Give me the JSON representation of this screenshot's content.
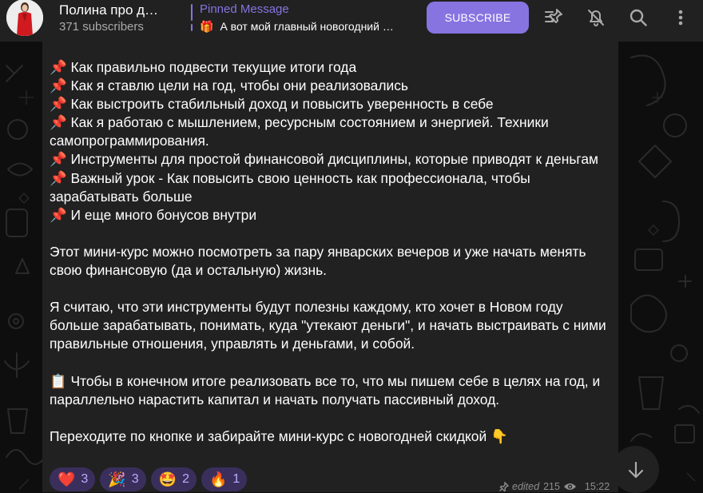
{
  "header": {
    "channel_title": "Полина про д…",
    "subscribers": "371 subscribers",
    "pinned_label": "Pinned Message",
    "pinned_emoji": "🎁",
    "pinned_text": "А вот мой главный новогодний …",
    "subscribe_label": "SUBSCRIBE",
    "icons": [
      "pinned-list-icon",
      "mute-bell-icon",
      "search-icon",
      "more-vertical-icon"
    ]
  },
  "message": {
    "lines": [
      "📌  Как правильно подвести текущие итоги года",
      "📌  Как я ставлю цели на год, чтобы они реализовались",
      "📌  Как выстроить стабильный доход и повысить уверенность в себе",
      "📌  Как я работаю с мышлением, ресурсным состоянием и энергией. Техники самопрограммирования.",
      "📌  Инструменты для простой финансовой дисциплины, которые приводят к деньгам",
      "📌  Важный урок - Как повысить свою ценность как профессионала, чтобы зарабатывать больше",
      "📌  И еще много бонусов внутри"
    ],
    "paragraph_1": "Этот мини-курс можно посмотреть за пару январских вечеров и уже начать менять свою финансовую (да и остальную) жизнь.",
    "paragraph_2": "Я считаю, что эти инструменты будут полезны каждому, кто хочет в Новом году больше зарабатывать, понимать, куда \"утекают деньги\", и начать выстраивать с ними правильные отношения, управлять и деньгами, и собой.",
    "paragraph_3": "📋 Чтобы в конечном итоге реализовать все то, что мы пишем себе в целях на год, и параллельно нарастить капитал и начать получать пассивный доход.",
    "paragraph_4": "Переходите по кнопке и забирайте мини-курс с новогодней скидкой 👇"
  },
  "reactions": [
    {
      "emoji": "❤️",
      "count": "3"
    },
    {
      "emoji": "🎉",
      "count": "3"
    },
    {
      "emoji": "🤩",
      "count": "2"
    },
    {
      "emoji": "🔥",
      "count": "1"
    }
  ],
  "meta": {
    "edited": "edited",
    "views": "215",
    "time": "15:22"
  },
  "colors": {
    "accent": "#8774e1",
    "header_bg": "#212121",
    "bubble_bg": "#212121",
    "reaction_bg": "#3a2f5c"
  }
}
